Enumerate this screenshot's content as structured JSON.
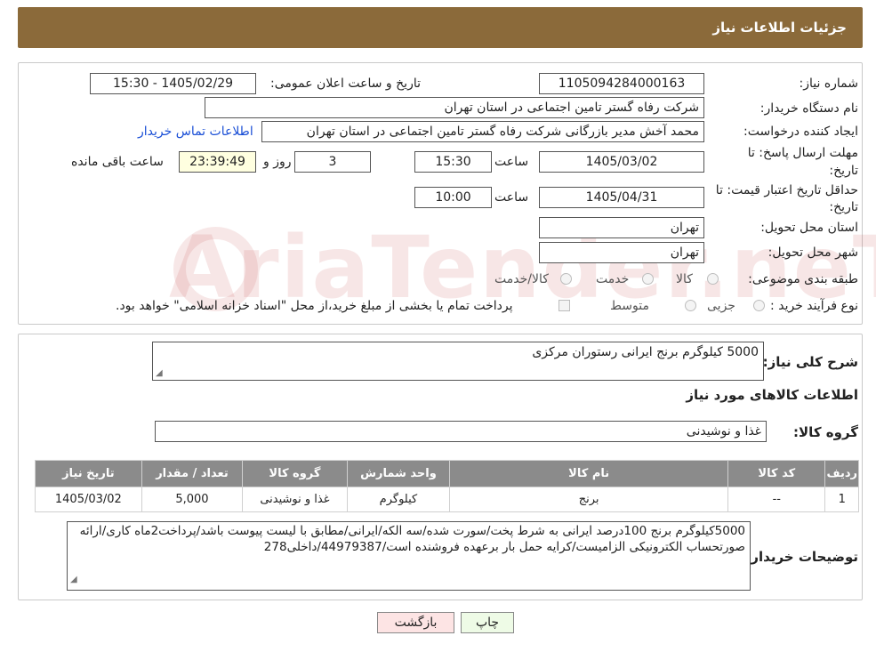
{
  "header": {
    "title": "جزئیات اطلاعات نیاز"
  },
  "watermark": {
    "text": "AriaTender.neT"
  },
  "form": {
    "need_number_label": "شماره نیاز:",
    "need_number": "1105094284000163",
    "announce_label": "تاریخ و ساعت اعلان عمومی:",
    "announce_value": "1405/02/29 - 15:30",
    "buyer_org_label": "نام دستگاه خریدار:",
    "buyer_org": "شرکت رفاه گستر تامین اجتماعی در استان تهران",
    "creator_label": "ایجاد کننده درخواست:",
    "creator": "محمد آخش مدیر بازرگانی شرکت رفاه گستر تامین اجتماعی در استان تهران",
    "contact_link": "اطلاعات تماس خریدار",
    "deadline_label_1": "مهلت ارسال پاسخ: تا",
    "deadline_label_2": "تاریخ:",
    "deadline_date": "1405/03/02",
    "time_label": "ساعت",
    "deadline_time": "15:30",
    "days_value": "3",
    "days_label": "روز و",
    "remaining_time": "23:39:49",
    "remaining_label": "ساعت باقی مانده",
    "validity_label_1": "حداقل تاریخ اعتبار قیمت: تا",
    "validity_label_2": "تاریخ:",
    "validity_date": "1405/04/31",
    "validity_time": "10:00",
    "province_label": "استان محل تحویل:",
    "province": "تهران",
    "city_label": "شهر محل تحویل:",
    "city": "تهران",
    "category_label": "طبقه بندی موضوعی:",
    "category_options": [
      "کالا",
      "خدمت",
      "کالا/خدمت"
    ],
    "process_label": "نوع فرآیند خرید :",
    "process_options": [
      "جزیی",
      "متوسط"
    ],
    "process_note": "پرداخت تمام یا بخشی از مبلغ خرید،از محل \"اسناد خزانه اسلامی\" خواهد بود."
  },
  "summary": {
    "description_label": "شرح کلی نیاز:",
    "description": "5000 کیلوگرم برنج ایرانی رستوران مرکزی",
    "items_title": "اطلاعات کالاهای مورد نیاز",
    "group_label": "گروه کالا:",
    "group_value": "غذا و نوشیدنی",
    "table": {
      "headers": [
        "ردیف",
        "کد کالا",
        "نام کالا",
        "واحد شمارش",
        "گروه کالا",
        "تعداد / مقدار",
        "تاریخ نیاز"
      ],
      "rows": [
        [
          "1",
          "--",
          "برنج",
          "کیلوگرم",
          "غذا و نوشیدنی",
          "5,000",
          "1405/03/02"
        ]
      ]
    },
    "buyer_notes_label": "توضیحات خریدار:",
    "buyer_notes": "5000کیلوگرم برنج 100درصد ایرانی به شرط پخت/سورت شده/سه الکه/ایرانی/مطابق با لیست پیوست باشد/پرداخت2ماه کاری/ارائه صورتحساب الکترونیکی الزامیست/کرایه حمل بار برعهده فروشنده است/44979387/داخلی278"
  },
  "buttons": {
    "print": "چاپ",
    "back": "بازگشت"
  },
  "colors": {
    "header": "#8b6a3a",
    "table_header": "#8b8b8b",
    "timer_bg": "#ffffe0",
    "link": "#1a4fd6",
    "back_bg": "#fde4e4",
    "print_bg": "#eefbe6"
  }
}
